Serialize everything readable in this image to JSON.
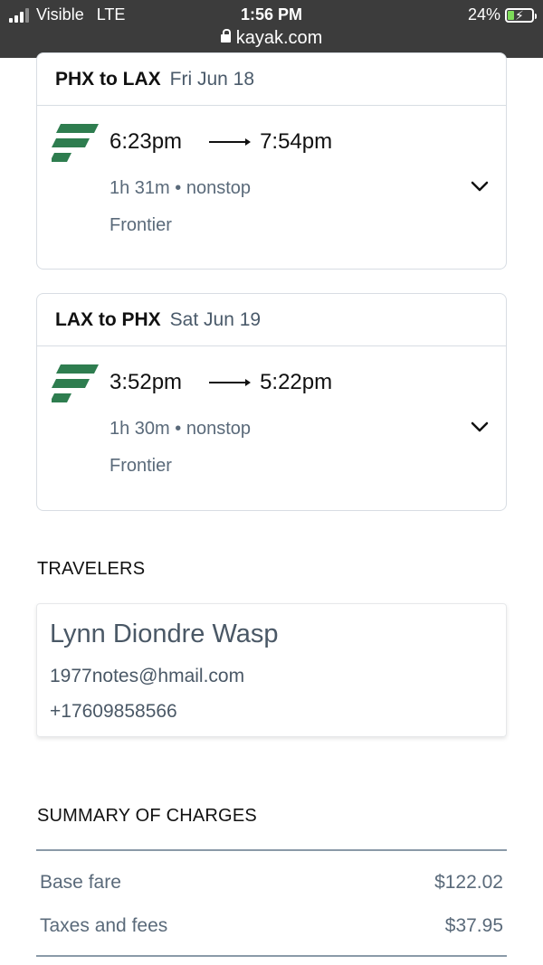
{
  "status_bar": {
    "carrier": "Visible",
    "network": "LTE",
    "time": "1:56 PM",
    "url": "kayak.com",
    "battery": "24%",
    "battery_color": "#7ddb59"
  },
  "flights": [
    {
      "route": "PHX to LAX",
      "date": "Fri Jun 18",
      "depart": "6:23pm",
      "arrive": "7:54pm",
      "meta": "1h 31m • nonstop",
      "airline": "Frontier",
      "logo_icon": "frontier-logo-icon",
      "logo_color": "#2e7d4f"
    },
    {
      "route": "LAX to PHX",
      "date": "Sat Jun 19",
      "depart": "3:52pm",
      "arrive": "5:22pm",
      "meta": "1h 30m • nonstop",
      "airline": "Frontier",
      "logo_icon": "frontier-logo-icon",
      "logo_color": "#2e7d4f"
    }
  ],
  "travelers": {
    "title": "TRAVELERS",
    "name": "Lynn Diondre Wasp",
    "email": "1977notes@hmail.com",
    "phone": "+17609858566"
  },
  "charges": {
    "title": "SUMMARY OF CHARGES",
    "rows": [
      {
        "label": "Base fare",
        "value": "$122.02"
      },
      {
        "label": "Taxes and fees",
        "value": "$37.95"
      }
    ]
  }
}
